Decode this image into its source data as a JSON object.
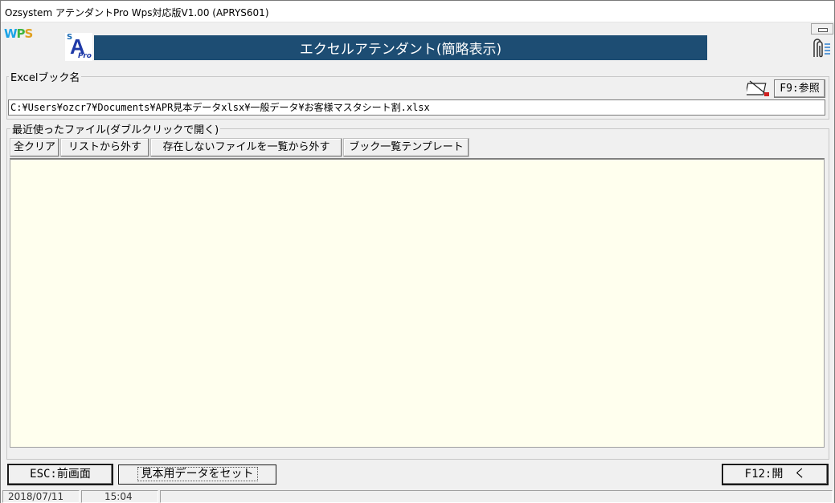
{
  "window": {
    "title": "Ozsystem アテンダントPro Wps対応版V1.00 (APRYS601)"
  },
  "header": {
    "logo_wps": {
      "w": "W",
      "p": "P",
      "s": "S"
    },
    "logo_sa": {
      "s": "S",
      "a": "A",
      "pro": "Pro"
    },
    "banner": "エクセルアテンダント(簡略表示)"
  },
  "book_group": {
    "label": "Excelブック名",
    "browse_button": "F9:参照",
    "path": "C:¥Users¥ozcr7¥Documents¥APR見本データxlsx¥一般データ¥お客様マスタシート割.xlsx"
  },
  "recent_group": {
    "label": "最近使ったファイル(ダブルクリックで開く)",
    "toolbar": {
      "clear_all": "全クリア",
      "remove": "リストから外す",
      "remove_missing": "存在しないファイルを一覧から外す",
      "template": "ブック一覧テンプレート"
    },
    "files": []
  },
  "footer": {
    "esc_button": "ESC:前画面",
    "sample_button": "見本用データをセット",
    "open_button": "F12:開　く"
  },
  "status": {
    "date": "2018/07/11",
    "time": "15:04"
  },
  "colors": {
    "banner_bg": "#1d4d73",
    "list_bg": "#ffffee",
    "window_bg": "#f0f0f0"
  }
}
